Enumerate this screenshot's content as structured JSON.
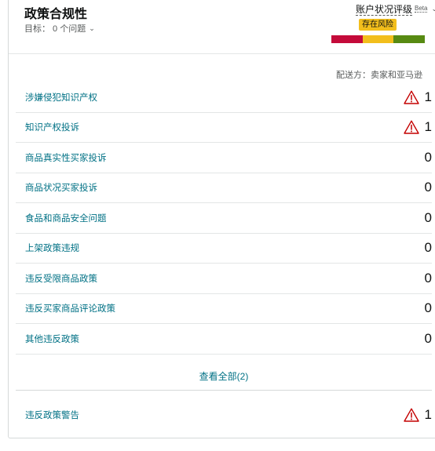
{
  "header": {
    "title": "政策合规性",
    "target": "目标： 0 个问题",
    "ahr_label": "账户状况评级",
    "beta": "Beta",
    "risk_badge": "存在风险",
    "bar_colors": [
      "#c40a3a",
      "#f2be1c",
      "#578a12"
    ]
  },
  "ship_by": "配送方：卖家和亚马逊",
  "policies": [
    {
      "label": "涉嫌侵犯知识产权",
      "count": "1",
      "warning": true
    },
    {
      "label": "知识产权投诉",
      "count": "1",
      "warning": true
    },
    {
      "label": "商品真实性买家投诉",
      "count": "0",
      "warning": false
    },
    {
      "label": "商品状况买家投诉",
      "count": "0",
      "warning": false
    },
    {
      "label": "食品和商品安全问题",
      "count": "0",
      "warning": false
    },
    {
      "label": "上架政策违规",
      "count": "0",
      "warning": false
    },
    {
      "label": "违反受限商品政策",
      "count": "0",
      "warning": false
    },
    {
      "label": "违反买家商品评论政策",
      "count": "0",
      "warning": false
    },
    {
      "label": "其他违反政策",
      "count": "0",
      "warning": false
    }
  ],
  "view_all": "查看全部(2)",
  "footer": {
    "label": "违反政策警告",
    "count": "1",
    "warning": true
  },
  "colors": {
    "link": "#007185",
    "warning": "#c40000"
  }
}
